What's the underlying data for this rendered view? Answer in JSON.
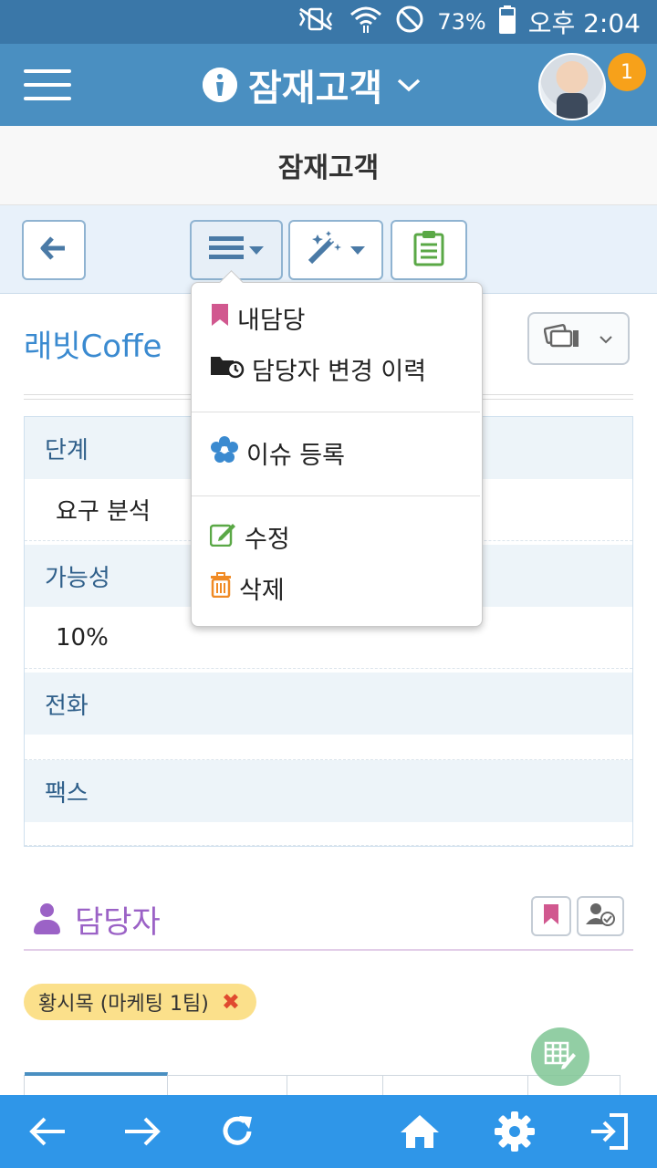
{
  "status_bar": {
    "battery": "73%",
    "time": "오후 2:04",
    "icons": [
      "mute-vibrate-icon",
      "wifi-icon",
      "no-sign-icon",
      "battery-icon"
    ]
  },
  "app_bar": {
    "title": "잠재고객",
    "notification_count": "1",
    "menu_icon": "hamburger-icon",
    "title_icon": "info-icon"
  },
  "page": {
    "title": "잠재고객"
  },
  "toolbar": {
    "buttons": [
      "back-arrow-icon",
      "list-menu-icon",
      "magic-wand-icon",
      "clipboard-icon"
    ]
  },
  "record": {
    "name": "래빗Coffe",
    "fields": [
      {
        "label": "단계",
        "value": "요구 분석"
      },
      {
        "label": "가능성",
        "value": "10%"
      },
      {
        "label": "전화",
        "value": ""
      },
      {
        "label": "팩스",
        "value": ""
      }
    ]
  },
  "owner_section": {
    "title": "담당자",
    "chip_label": "황시목 (마케팅 1팀)",
    "chip_remove": "✖"
  },
  "dropdown_menu": {
    "items": [
      {
        "label": "내담당",
        "icon": "bookmark-icon",
        "color": "#d1588f"
      },
      {
        "label": "담당자 변경 이력",
        "icon": "folder-history-icon",
        "color": "#222222"
      },
      {
        "label": "이슈 등록",
        "icon": "flower-icon",
        "color": "#3a8ad0"
      },
      {
        "label": "수정",
        "icon": "edit-icon",
        "color": "#5aa846"
      },
      {
        "label": "삭제",
        "icon": "trash-icon",
        "color": "#f08a24"
      }
    ]
  },
  "bottom_nav": {
    "items": [
      "back-icon",
      "forward-icon",
      "refresh-icon",
      "home-icon",
      "settings-icon",
      "logout-icon"
    ]
  },
  "colors": {
    "status_bar": "#3a77a8",
    "app_bar": "#4a8fc1",
    "bottom_bar": "#2f96e8",
    "accent_purple": "#9b62c6",
    "link_blue": "#3a8ad0"
  }
}
